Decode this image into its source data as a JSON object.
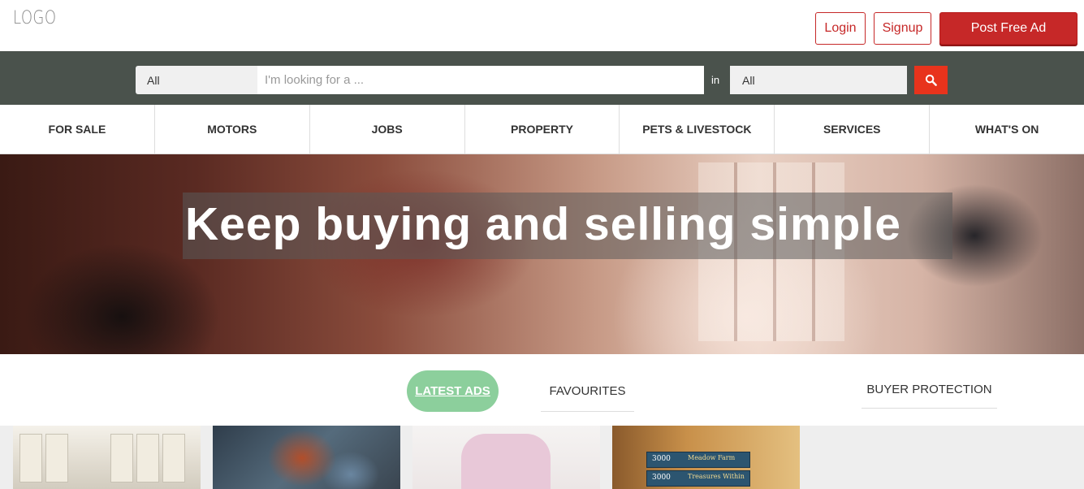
{
  "header": {
    "logo": "LOGO",
    "login_label": "Login",
    "signup_label": "Signup",
    "post_label": "Post Free Ad"
  },
  "search": {
    "category_value": "All",
    "placeholder": "I'm looking for a ...",
    "in_label": "in",
    "location_value": "All",
    "button_icon": "search-icon"
  },
  "nav": {
    "items": [
      {
        "label": "FOR SALE"
      },
      {
        "label": "MOTORS"
      },
      {
        "label": "JOBS"
      },
      {
        "label": "PROPERTY"
      },
      {
        "label": "PETS & LIVESTOCK"
      },
      {
        "label": "SERVICES"
      },
      {
        "label": "WHAT'S ON"
      }
    ]
  },
  "hero": {
    "title": "Keep buying and selling simple"
  },
  "tabs": {
    "latest_label": "LATEST ADS",
    "favourites_label": "FAVOURITES",
    "buyer_label": "BUYER PROTECTION"
  },
  "listings": {
    "card4_box1": {
      "count": "3000",
      "title": "Meadow Farm"
    },
    "card4_box2": {
      "count": "3000",
      "title": "Treasures Within"
    }
  },
  "colors": {
    "brand_red": "#c62828",
    "search_bar_bg": "#4a524c",
    "search_button": "#e8331c",
    "active_tab": "#8ccf9c"
  }
}
